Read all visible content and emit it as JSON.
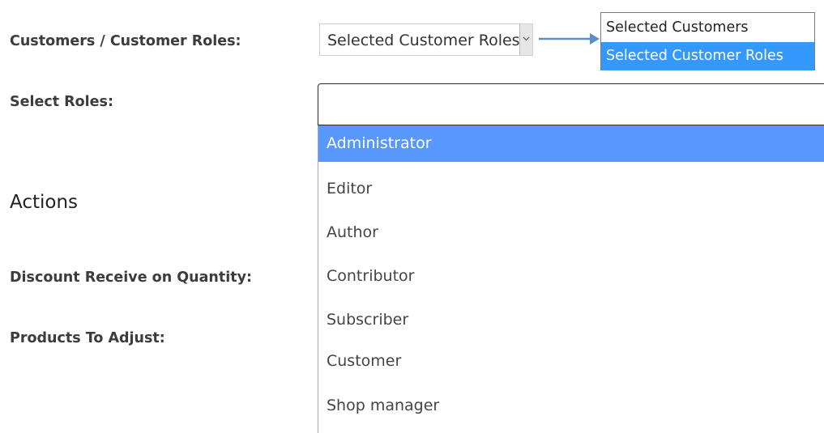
{
  "form": {
    "customers_label": "Customers / Customer Roles:",
    "select_roles_label": "Select Roles:",
    "actions_heading": "Actions",
    "discount_label": "Discount Receive on Quantity:",
    "products_label": "Products To Adjust:"
  },
  "customer_type_select": {
    "selected_value": "Selected Customer Roles",
    "options": [
      {
        "label": "Selected Customers",
        "selected": false
      },
      {
        "label": "Selected Customer Roles",
        "selected": true
      }
    ]
  },
  "roles_select": {
    "search_value": "",
    "options": [
      {
        "label": "Administrator",
        "highlighted": true
      },
      {
        "label": "Editor",
        "highlighted": false
      },
      {
        "label": "Author",
        "highlighted": false
      },
      {
        "label": "Contributor",
        "highlighted": false
      },
      {
        "label": "Subscriber",
        "highlighted": false
      },
      {
        "label": "Customer",
        "highlighted": false
      },
      {
        "label": "Shop manager",
        "highlighted": false
      }
    ]
  },
  "colors": {
    "native_option_selected": "#3399ff",
    "role_highlight": "#5897fb",
    "annotation_arrow": "#5b8ec9"
  },
  "icons": {
    "dropdown": "chevron-down-icon",
    "annotation": "arrow-right-icon"
  }
}
